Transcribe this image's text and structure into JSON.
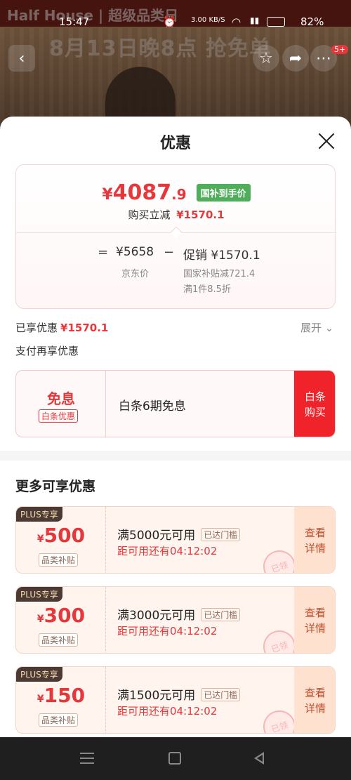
{
  "background": {
    "banner_text": "Half House | 超级品类日",
    "promo_text": "8月13日晚8点 抢免单"
  },
  "status_bar": {
    "time": "15:47",
    "net_speed": "3.00 KB/S",
    "battery": "82%"
  },
  "top_nav": {
    "badge": "5+"
  },
  "sheet": {
    "title": "优惠",
    "price": {
      "currency": "¥",
      "integer": "4087",
      "decimal": ".9",
      "tag": "国补到手价"
    },
    "reduce": {
      "label": "购买立减",
      "value": "¥1570.1"
    },
    "formula": {
      "equals": "=",
      "jd_price": "¥5658",
      "jd_label": "京东价",
      "minus": "−",
      "promo": "促销 ¥1570.1",
      "promo_detail_1": "国家补贴减721.4",
      "promo_detail_2": "满1件8.5折"
    },
    "enjoyed": {
      "label": "已享优惠",
      "value": "¥1570.1"
    },
    "expand_label": "展开 ⌄",
    "pay_title": "支付再享优惠",
    "baitiao": {
      "big": "免息",
      "small": "白条优惠",
      "desc": "白条6期免息",
      "buy_line1": "白条",
      "buy_line2": "购买"
    },
    "more_title": "更多可享优惠",
    "coupons": [
      {
        "plus": "PLUS专享",
        "cur": "¥",
        "amount": "500",
        "sub": "品类补贴",
        "cond": "满5000元可用",
        "badge": "已达门槛",
        "countdown": "距可用还有04:12:02",
        "stamp": "已领",
        "detail1": "查看",
        "detail2": "详情"
      },
      {
        "plus": "PLUS专享",
        "cur": "¥",
        "amount": "300",
        "sub": "品类补贴",
        "cond": "满3000元可用",
        "badge": "已达门槛",
        "countdown": "距可用还有04:12:02",
        "stamp": "已领",
        "detail1": "查看",
        "detail2": "详情"
      },
      {
        "plus": "PLUS专享",
        "cur": "¥",
        "amount": "150",
        "sub": "品类补贴",
        "cond": "满1500元可用",
        "badge": "已达门槛",
        "countdown": "距可用还有04:12:02",
        "stamp": "已领",
        "detail1": "查看",
        "detail2": "详情"
      }
    ]
  },
  "colors": {
    "accent_red": "#e4393c",
    "tag_green": "#4fae5a",
    "buy_red": "#f0222a"
  }
}
